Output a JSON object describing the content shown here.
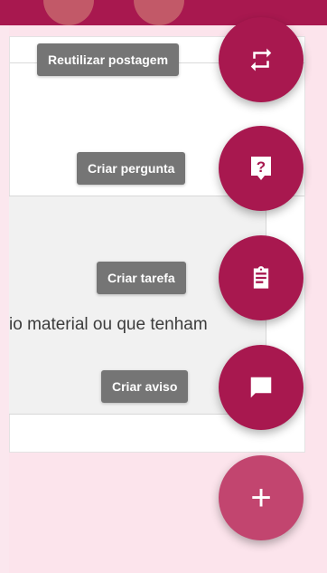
{
  "colors": {
    "fab_primary": "#a8184f",
    "fab_main": "#c2456f",
    "tooltip_bg": "#757575",
    "page_bg": "#fce4ec"
  },
  "content": {
    "snippet": "io material ou que tenham"
  },
  "actions": [
    {
      "label": "Reutilizar postagem",
      "icon": "repeat-icon"
    },
    {
      "label": "Criar pergunta",
      "icon": "question-icon"
    },
    {
      "label": "Criar tarefa",
      "icon": "assignment-icon"
    },
    {
      "label": "Criar aviso",
      "icon": "comment-icon"
    }
  ],
  "main_fab": {
    "symbol": "+",
    "icon": "plus-icon"
  }
}
